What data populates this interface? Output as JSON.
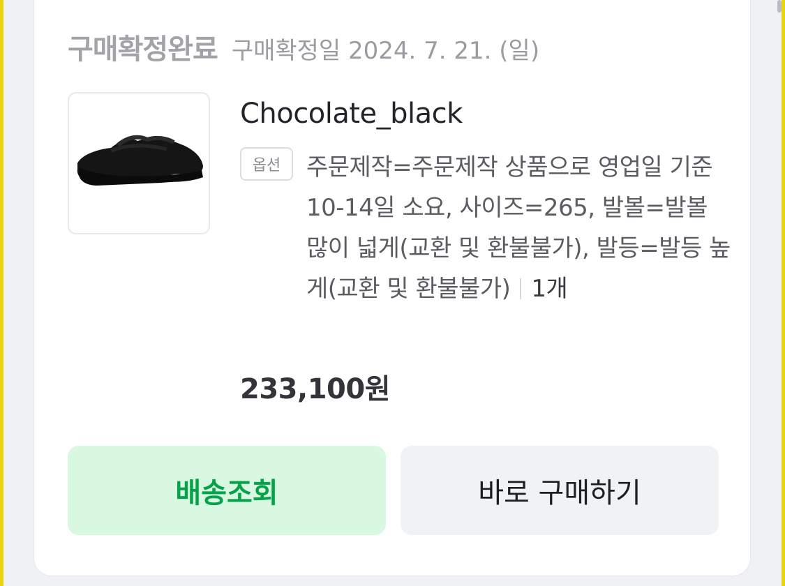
{
  "order": {
    "status_title": "구매확정완료",
    "confirm_date": "구매확정일 2024. 7. 21. (일)"
  },
  "product": {
    "name": "Chocolate_black",
    "option_badge": "옵션",
    "option_text": "주문제작=주문제작 상품으로 영업일 기준 10-14일 소요, 사이즈=265, 발볼=발볼 많이 넓게(교환 및 환불불가), 발등=발등 높게(교환 및 환불불가)",
    "quantity": "1개",
    "price": "233,100원",
    "image_icon": "shoe-image"
  },
  "actions": {
    "track_label": "배송조회",
    "buy_again_label": "바로 구매하기"
  },
  "colors": {
    "accent_green": "#06a24a",
    "accent_green_bg": "#d8f8e2"
  }
}
